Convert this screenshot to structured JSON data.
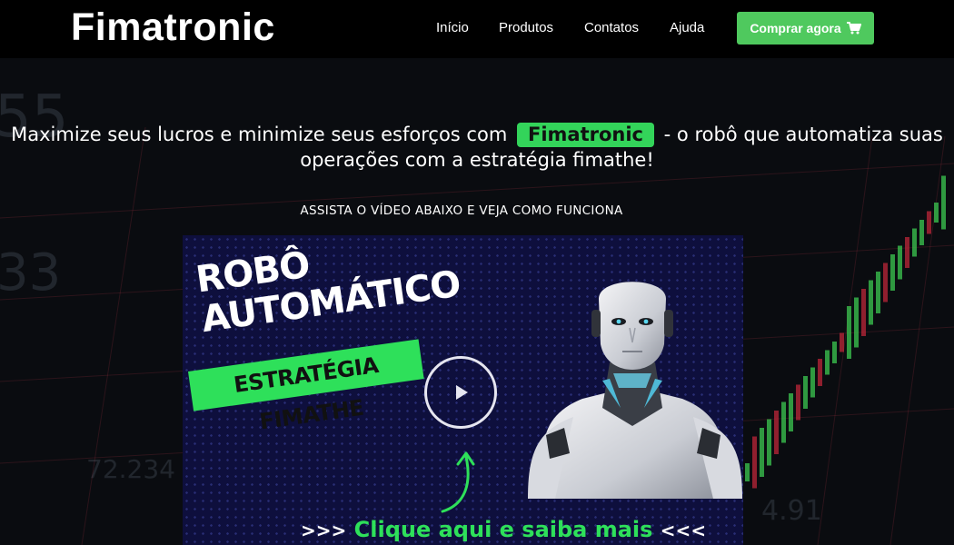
{
  "header": {
    "logo": "Fimatronic",
    "nav": [
      "Início",
      "Produtos",
      "Contatos",
      "Ajuda"
    ],
    "buy_label": "Comprar agora",
    "buy_icon": "shopping-cart-icon"
  },
  "hero": {
    "headline_before": "Maximize seus lucros e minimize seus esforços com",
    "brand": "Fimatronic",
    "headline_after": "- o robô que automatiza suas operações com a estratégia fimathe!",
    "subhead": "ASSISTA O VÍDEO ABAIXO E VEJA COMO FUNCIONA"
  },
  "video": {
    "title_line1": "ROBÔ",
    "title_line2": "AUTOMÁTICO",
    "banner": "ESTRATÉGIA FIMATHE",
    "cta_prefix": ">>>",
    "cta": "Clique aqui e saiba mais",
    "cta_suffix": "<<<",
    "play_icon": "play-icon"
  },
  "background_numbers": [
    "72.234",
    "4.91",
    "55",
    "33"
  ],
  "colors": {
    "accent_green": "#4fc95e",
    "brand_tag": "#33d45a",
    "video_bg": "#0e0f3d",
    "header_bg": "#000000"
  }
}
